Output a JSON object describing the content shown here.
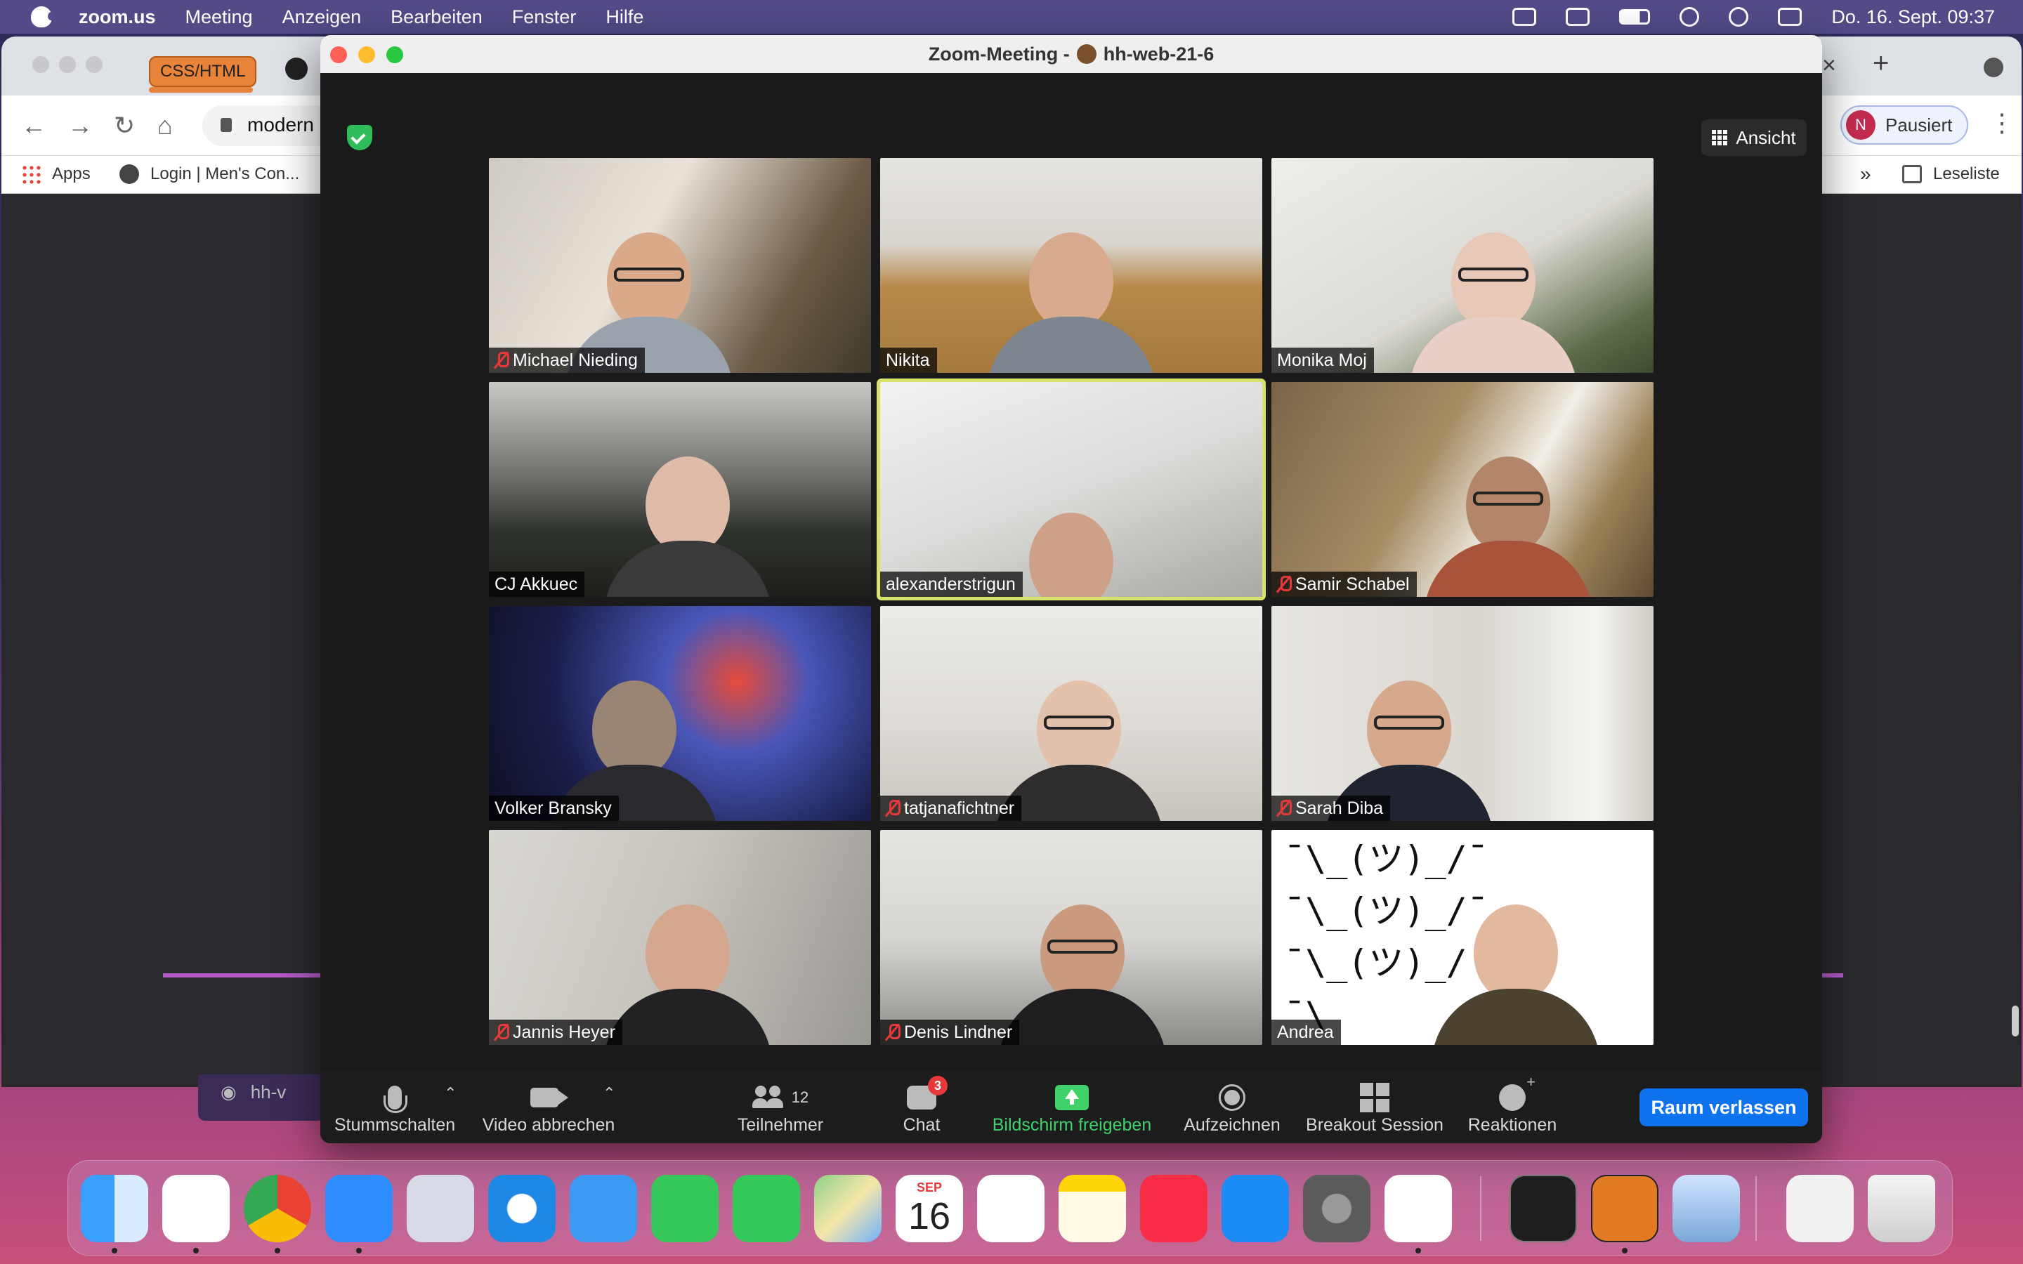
{
  "menubar": {
    "app": "zoom.us",
    "items": [
      "Meeting",
      "Anzeigen",
      "Bearbeiten",
      "Fenster",
      "Hilfe"
    ],
    "datetime": "Do. 16. Sept. 09:37"
  },
  "chrome": {
    "tab_label": "CSS/HTML",
    "url_partial": "modern",
    "profile_initial": "N",
    "profile_status": "Pausiert",
    "bookmarks": {
      "apps": "Apps",
      "login": "Login | Men's Con...",
      "more": "»",
      "reading_list": "Leseliste"
    },
    "bottom_panel_text": "hh-v"
  },
  "zoom": {
    "window_title_prefix": "Zoom-Meeting -",
    "window_title_room": "hh-web-21-6",
    "view_button": "Ansicht",
    "participants": [
      {
        "name": "Michael Nieding",
        "muted": true
      },
      {
        "name": "Nikita",
        "muted": false
      },
      {
        "name": "Monika Moj",
        "muted": false
      },
      {
        "name": "CJ Akkuec",
        "muted": false
      },
      {
        "name": "alexanderstrigun",
        "muted": false,
        "active_speaker": true
      },
      {
        "name": "Samir Schabel",
        "muted": true
      },
      {
        "name": "Volker Bransky",
        "muted": false
      },
      {
        "name": "tatjanafichtner",
        "muted": true
      },
      {
        "name": "Sarah Diba",
        "muted": true
      },
      {
        "name": "Jannis Heyer",
        "muted": true
      },
      {
        "name": "Denis Lindner",
        "muted": true
      },
      {
        "name": "Andrea",
        "muted": false
      }
    ],
    "shrug_lines": [
      "¯\\_(ツ)_/¯",
      "¯\\_(ツ)_/¯",
      "¯\\_(ツ)_/",
      "¯\\"
    ],
    "toolbar": {
      "mute": "Stummschalten",
      "video": "Video abbrechen",
      "participants": "Teilnehmer",
      "participants_count": "12",
      "chat": "Chat",
      "chat_badge": "3",
      "share": "Bildschirm freigeben",
      "record": "Aufzeichnen",
      "breakout": "Breakout Session",
      "reactions": "Reaktionen",
      "leave": "Raum verlassen"
    }
  },
  "dock": {
    "calendar_month": "SEP",
    "calendar_day": "16",
    "apps": [
      "finder-icon",
      "slack-icon",
      "chrome-icon",
      "zoom-icon",
      "launchpad-icon",
      "safari-icon",
      "mail-icon",
      "facetime-icon",
      "messages-icon",
      "maps-icon",
      "calendar-icon",
      "reminders-icon",
      "notes-icon",
      "music-icon",
      "app-store-icon",
      "system-preferences-icon",
      "vscode-icon",
      "terminal-icon",
      "books-icon",
      "preview-icon",
      "downloads-stack-icon",
      "trash-icon"
    ]
  },
  "colors": {
    "zoom_blue": "#0e72ed",
    "share_green": "#3fd26a",
    "mute_red": "#e8393a",
    "active_speaker": "#d6e26b"
  }
}
